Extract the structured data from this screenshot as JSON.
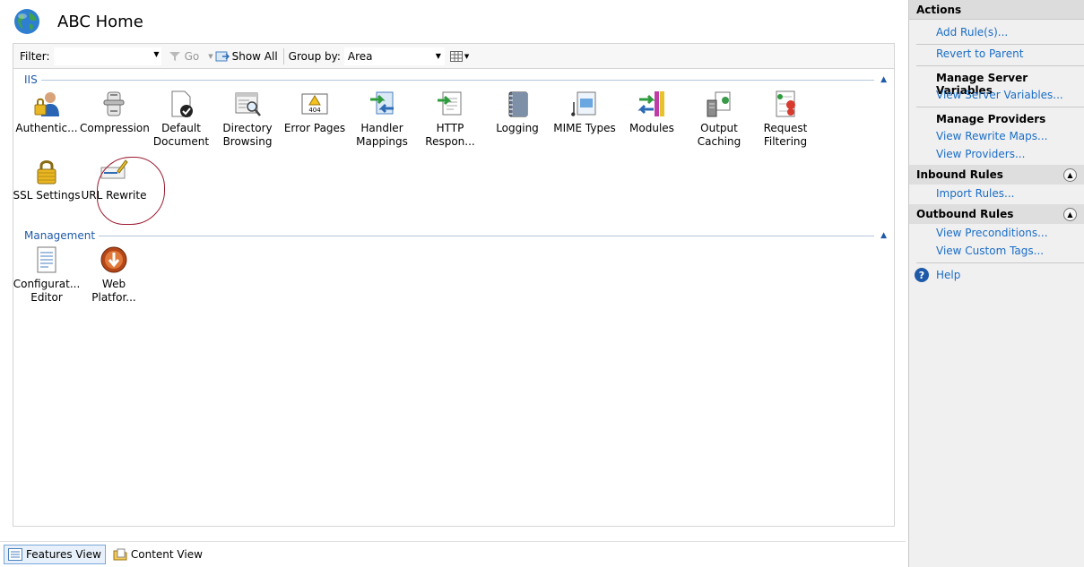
{
  "header": {
    "title": "ABC Home"
  },
  "toolbar": {
    "filter_label": "Filter:",
    "go_label": "Go",
    "show_all_label": "Show All",
    "group_by_label": "Group by:",
    "group_by_value": "Area"
  },
  "groups": {
    "iis": {
      "name": "IIS",
      "items": [
        {
          "label": "Authentic...",
          "icon": "authentication-icon"
        },
        {
          "label": "Compression",
          "icon": "compression-icon"
        },
        {
          "label": "Default\nDocument",
          "icon": "default-document-icon"
        },
        {
          "label": "Directory\nBrowsing",
          "icon": "directory-browsing-icon"
        },
        {
          "label": "Error Pages",
          "icon": "error-pages-icon"
        },
        {
          "label": "Handler\nMappings",
          "icon": "handler-mappings-icon"
        },
        {
          "label": "HTTP\nRespon...",
          "icon": "http-response-icon"
        },
        {
          "label": "Logging",
          "icon": "logging-icon"
        },
        {
          "label": "MIME Types",
          "icon": "mime-types-icon"
        },
        {
          "label": "Modules",
          "icon": "modules-icon"
        },
        {
          "label": "Output\nCaching",
          "icon": "output-caching-icon"
        },
        {
          "label": "Request\nFiltering",
          "icon": "request-filtering-icon"
        },
        {
          "label": "SSL Settings",
          "icon": "ssl-settings-icon"
        },
        {
          "label": "URL Rewrite",
          "icon": "url-rewrite-icon"
        }
      ]
    },
    "management": {
      "name": "Management",
      "items": [
        {
          "label": "Configurat...\nEditor",
          "icon": "configuration-editor-icon"
        },
        {
          "label": "Web\nPlatfor...",
          "icon": "web-platform-icon"
        }
      ]
    }
  },
  "bottom_tabs": {
    "features_view": "Features View",
    "content_view": "Content View"
  },
  "actions": {
    "title": "Actions",
    "add_rules": "Add Rule(s)...",
    "revert_to_parent": "Revert to Parent",
    "manage_server_variables": "Manage Server Variables",
    "view_server_variables": "View Server Variables...",
    "manage_providers": "Manage Providers",
    "view_rewrite_maps": "View Rewrite Maps...",
    "view_providers": "View Providers...",
    "inbound_rules": "Inbound Rules",
    "import_rules": "Import Rules...",
    "outbound_rules": "Outbound Rules",
    "view_preconditions": "View Preconditions...",
    "view_custom_tags": "View Custom Tags...",
    "help": "Help"
  },
  "colors": {
    "link": "#1a6dc7",
    "group_header": "#1e5aa8",
    "highlight_circle": "#9b1b30"
  }
}
